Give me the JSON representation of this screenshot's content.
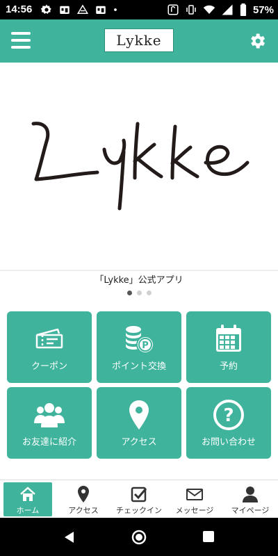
{
  "status_bar": {
    "time": "14:56",
    "battery_percent": "57%"
  },
  "header": {
    "logo_text": "Lykke"
  },
  "banner": {
    "logo_text": "Lykke",
    "caption": "「Lykke」公式アプリ",
    "slide_count": 3,
    "active_slide": 1
  },
  "tiles": [
    {
      "label": "クーポン",
      "icon": "ticket-icon"
    },
    {
      "label": "ポイント交換",
      "icon": "points-coin-icon"
    },
    {
      "label": "予約",
      "icon": "calendar-icon"
    },
    {
      "label": "お友達に紹介",
      "icon": "friends-icon"
    },
    {
      "label": "アクセス",
      "icon": "location-pin-icon"
    },
    {
      "label": "お問い合わせ",
      "icon": "question-icon"
    }
  ],
  "bottom_nav": [
    {
      "label": "ホーム",
      "icon": "home-icon",
      "active": true
    },
    {
      "label": "アクセス",
      "icon": "map-pin-icon",
      "active": false
    },
    {
      "label": "チェックイン",
      "icon": "checkbox-icon",
      "active": false
    },
    {
      "label": "メッセージ",
      "icon": "mail-icon",
      "active": false
    },
    {
      "label": "マイページ",
      "icon": "user-icon",
      "active": false
    }
  ],
  "colors": {
    "accent": "#3fb39c",
    "text_dark": "#222222"
  }
}
